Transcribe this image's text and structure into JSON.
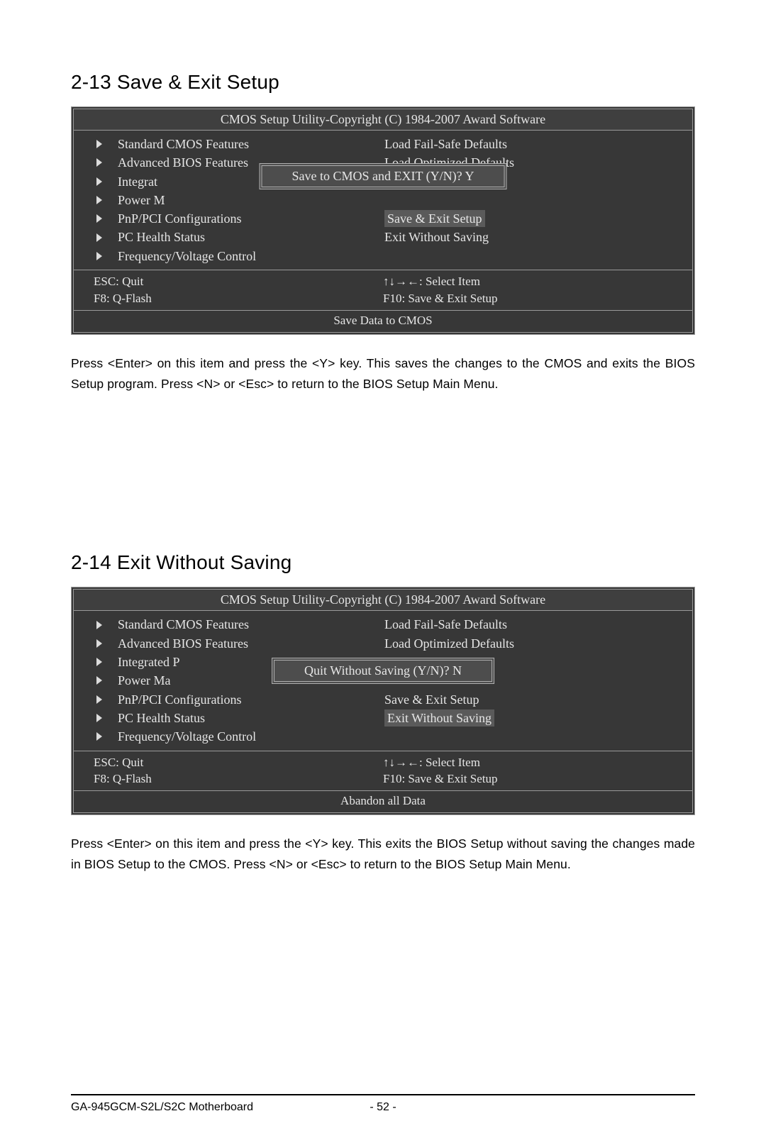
{
  "sec1": {
    "heading": "2-13   Save & Exit Setup",
    "panel_title": "CMOS Setup Utility-Copyright (C) 1984-2007 Award Software",
    "left": [
      "Standard CMOS Features",
      "Advanced BIOS Features",
      "Integrat",
      "Power M",
      "PnP/PCI Configurations",
      "PC Health Status",
      "Frequency/Voltage Control"
    ],
    "right": [
      "Load Fail-Safe Defaults",
      "Load Optimized Defaults",
      "",
      "",
      "Save & Exit Setup",
      "Exit Without Saving"
    ],
    "dialog": "Save to CMOS and EXIT (Y/N)? Y",
    "keys": {
      "l1": "ESC: Quit",
      "l2": "F8: Q-Flash",
      "r1": "↑↓→←: Select Item",
      "r2": "F10: Save & Exit Setup"
    },
    "help": "Save Data to CMOS",
    "desc": "Press <Enter> on this item and press the <Y> key. This saves the changes to the CMOS and exits the BIOS Setup program. Press <N> or <Esc> to return to the BIOS Setup Main Menu."
  },
  "sec2": {
    "heading": "2-14   Exit Without Saving",
    "panel_title": "CMOS Setup Utility-Copyright (C) 1984-2007 Award Software",
    "left": [
      "Standard CMOS Features",
      "Advanced BIOS Features",
      "Integrated P",
      "Power Ma",
      "PnP/PCI Configurations",
      "PC Health Status",
      "Frequency/Voltage Control"
    ],
    "right": [
      "Load Fail-Safe Defaults",
      "Load Optimized Defaults",
      "",
      "",
      "Save & Exit Setup",
      "Exit Without Saving"
    ],
    "dialog": "Quit Without Saving (Y/N)? N",
    "keys": {
      "l1": "ESC: Quit",
      "l2": "F8: Q-Flash",
      "r1": "↑↓→←: Select Item",
      "r2": "F10: Save & Exit Setup"
    },
    "help": "Abandon all Data",
    "desc": "Press <Enter> on this item and press the <Y> key. This exits the BIOS Setup without saving the changes made in BIOS Setup to the CMOS. Press <N> or <Esc> to return to the BIOS Setup Main Menu."
  },
  "footer": {
    "model": "GA-945GCM-S2L/S2C Motherboard",
    "page": "- 52 -"
  }
}
